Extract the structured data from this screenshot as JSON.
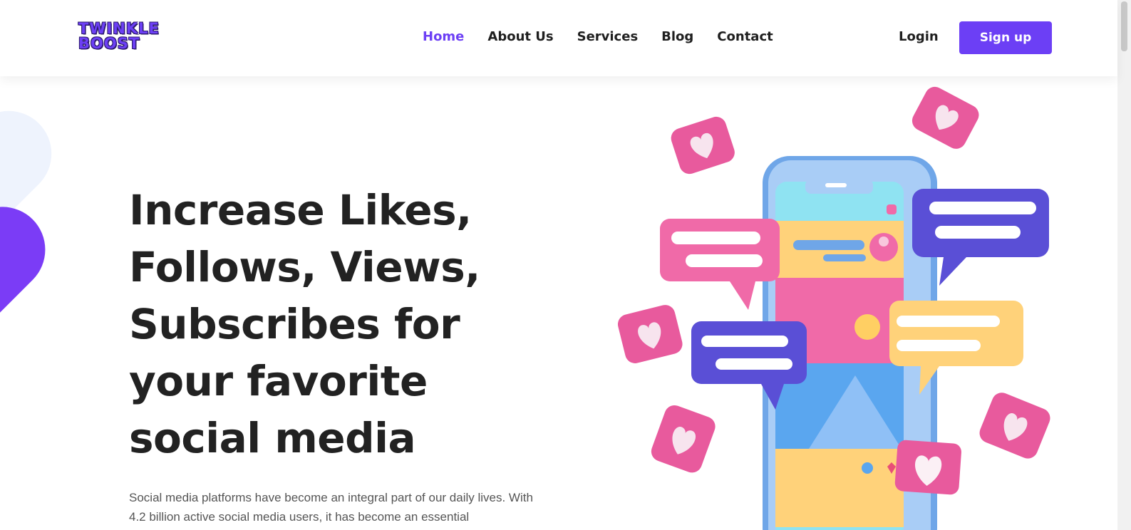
{
  "header": {
    "logo": {
      "line1": "TWINKLE",
      "line2": "BOOST"
    },
    "nav": [
      {
        "label": "Home",
        "active": true
      },
      {
        "label": "About Us",
        "active": false
      },
      {
        "label": "Services",
        "active": false
      },
      {
        "label": "Blog",
        "active": false
      },
      {
        "label": "Contact",
        "active": false
      }
    ],
    "login_label": "Login",
    "signup_label": "Sign up"
  },
  "hero": {
    "title_lines": [
      "Increase Likes,",
      "Follows, Views,",
      "Subscribes for",
      "your favorite",
      "social media"
    ],
    "description": "Social media platforms have become an integral part of our daily lives. With 4.2 billion active social media users, it has become an essential"
  },
  "illustration": {
    "icons": [
      "smartphone-icon",
      "heart-icon",
      "chat-bubble-icon"
    ]
  },
  "colors": {
    "accent": "#6c3ff5",
    "pink": "#f06aa8",
    "purple": "#5a4fd6",
    "yellow": "#ffd27a",
    "sky": "#8fe3f2",
    "light_blue_shape": "#eef3fd"
  }
}
